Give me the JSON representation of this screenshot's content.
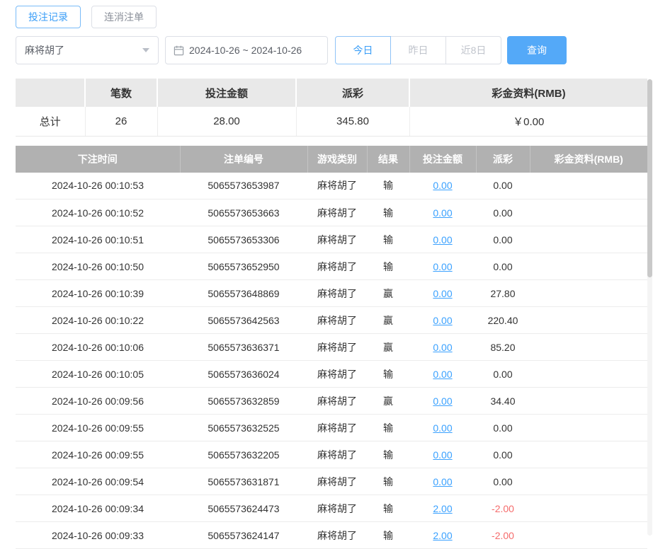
{
  "tabs": [
    {
      "label": "投注记录",
      "active": true
    },
    {
      "label": "连消注单",
      "active": false
    }
  ],
  "filters": {
    "game_select_value": "麻将胡了",
    "date_range_value": "2024-10-26 ~ 2024-10-26",
    "quick_buttons": [
      "今日",
      "昨日",
      "近8日"
    ],
    "active_quick_button": "今日",
    "query_label": "查询"
  },
  "summary": {
    "headers": [
      "",
      "笔数",
      "投注金额",
      "派彩",
      "彩金资料(RMB)"
    ],
    "total_label": "总计",
    "count": "26",
    "bet_amount": "28.00",
    "payout": "345.80",
    "bonus": "￥0.00"
  },
  "table": {
    "headers": [
      "下注时间",
      "注单编号",
      "游戏类别",
      "结果",
      "投注金额",
      "派彩",
      "彩金资料(RMB)"
    ],
    "rows": [
      {
        "time": "2024-10-26 00:10:53",
        "order": "5065573653987",
        "game": "麻将胡了",
        "result": "输",
        "bet": "0.00",
        "payout": "0.00",
        "bonus": "",
        "negative": false
      },
      {
        "time": "2024-10-26 00:10:52",
        "order": "5065573653663",
        "game": "麻将胡了",
        "result": "输",
        "bet": "0.00",
        "payout": "0.00",
        "bonus": "",
        "negative": false
      },
      {
        "time": "2024-10-26 00:10:51",
        "order": "5065573653306",
        "game": "麻将胡了",
        "result": "输",
        "bet": "0.00",
        "payout": "0.00",
        "bonus": "",
        "negative": false
      },
      {
        "time": "2024-10-26 00:10:50",
        "order": "5065573652950",
        "game": "麻将胡了",
        "result": "输",
        "bet": "0.00",
        "payout": "0.00",
        "bonus": "",
        "negative": false
      },
      {
        "time": "2024-10-26 00:10:39",
        "order": "5065573648869",
        "game": "麻将胡了",
        "result": "赢",
        "bet": "0.00",
        "payout": "27.80",
        "bonus": "",
        "negative": false
      },
      {
        "time": "2024-10-26 00:10:22",
        "order": "5065573642563",
        "game": "麻将胡了",
        "result": "赢",
        "bet": "0.00",
        "payout": "220.40",
        "bonus": "",
        "negative": false
      },
      {
        "time": "2024-10-26 00:10:06",
        "order": "5065573636371",
        "game": "麻将胡了",
        "result": "赢",
        "bet": "0.00",
        "payout": "85.20",
        "bonus": "",
        "negative": false
      },
      {
        "time": "2024-10-26 00:10:05",
        "order": "5065573636024",
        "game": "麻将胡了",
        "result": "输",
        "bet": "0.00",
        "payout": "0.00",
        "bonus": "",
        "negative": false
      },
      {
        "time": "2024-10-26 00:09:56",
        "order": "5065573632859",
        "game": "麻将胡了",
        "result": "赢",
        "bet": "0.00",
        "payout": "34.40",
        "bonus": "",
        "negative": false
      },
      {
        "time": "2024-10-26 00:09:55",
        "order": "5065573632525",
        "game": "麻将胡了",
        "result": "输",
        "bet": "0.00",
        "payout": "0.00",
        "bonus": "",
        "negative": false
      },
      {
        "time": "2024-10-26 00:09:55",
        "order": "5065573632205",
        "game": "麻将胡了",
        "result": "输",
        "bet": "0.00",
        "payout": "0.00",
        "bonus": "",
        "negative": false
      },
      {
        "time": "2024-10-26 00:09:54",
        "order": "5065573631871",
        "game": "麻将胡了",
        "result": "输",
        "bet": "0.00",
        "payout": "0.00",
        "bonus": "",
        "negative": false
      },
      {
        "time": "2024-10-26 00:09:34",
        "order": "5065573624473",
        "game": "麻将胡了",
        "result": "输",
        "bet": "2.00",
        "payout": "-2.00",
        "bonus": "",
        "negative": true
      },
      {
        "time": "2024-10-26 00:09:33",
        "order": "5065573624147",
        "game": "麻将胡了",
        "result": "输",
        "bet": "2.00",
        "payout": "-2.00",
        "bonus": "",
        "negative": true
      }
    ]
  },
  "colors": {
    "accent_blue": "#3b9ef7",
    "query_button_blue": "#54a9f8",
    "link_blue": "#3aa1ff",
    "negative_red": "#f56c6c",
    "table_header_gray": "#b1b1b1",
    "summary_header_gray": "#e9e9e9"
  }
}
